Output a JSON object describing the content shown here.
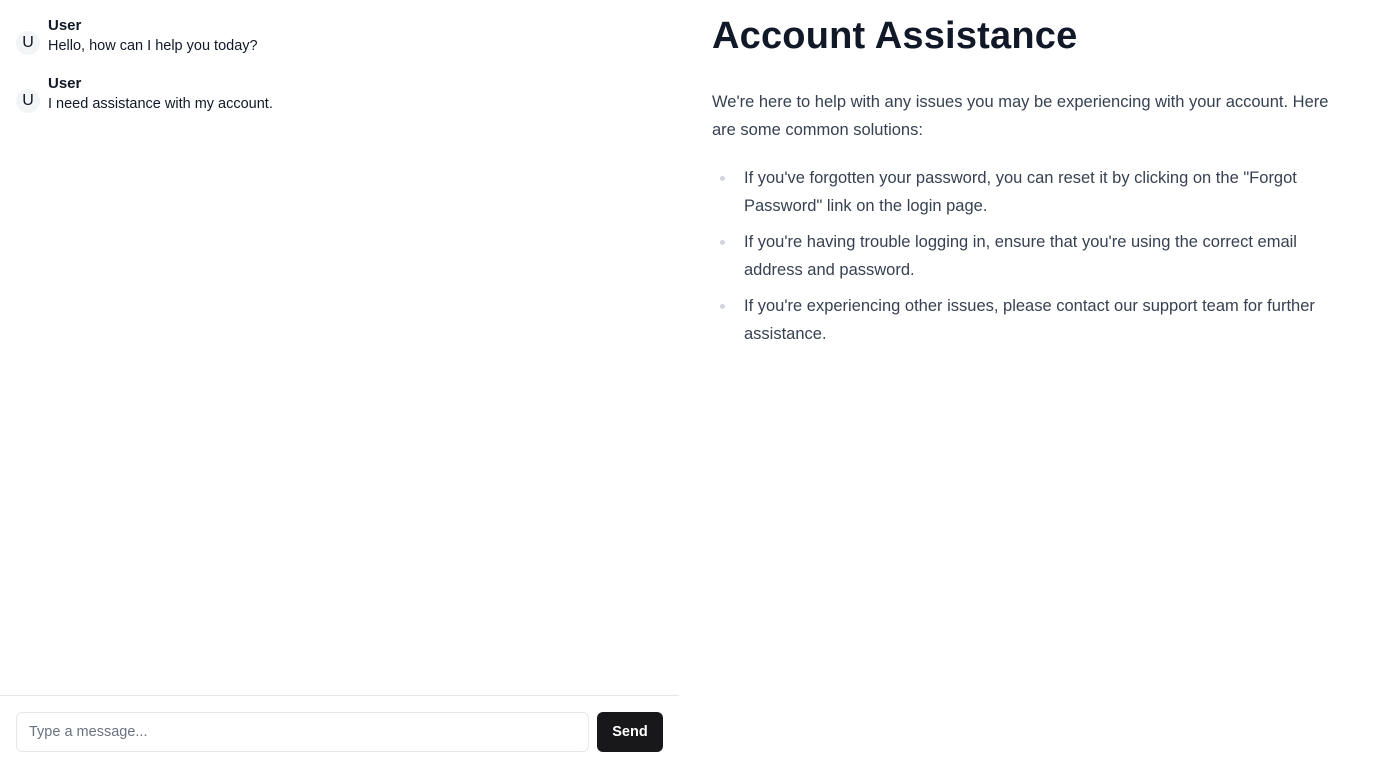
{
  "chat": {
    "messages": [
      {
        "avatar": "U",
        "sender": "User",
        "text": "Hello, how can I help you today?"
      },
      {
        "avatar": "U",
        "sender": "User",
        "text": "I need assistance with my account."
      }
    ],
    "input_placeholder": "Type a message...",
    "input_value": "",
    "send_label": "Send"
  },
  "content": {
    "title": "Account Assistance",
    "intro": "We're here to help with any issues you may be experiencing with your account. Here are some common solutions:",
    "solutions": [
      "If you've forgotten your password, you can reset it by clicking on the \"Forgot Password\" link on the login page.",
      "If you're having trouble logging in, ensure that you're using the correct email address and password.",
      "If you're experiencing other issues, please contact our support team for further assistance."
    ]
  },
  "colors": {
    "send_button_bg": "#18181b",
    "title_text": "#111827",
    "body_text": "#374151",
    "bullet": "#d1d5db"
  }
}
